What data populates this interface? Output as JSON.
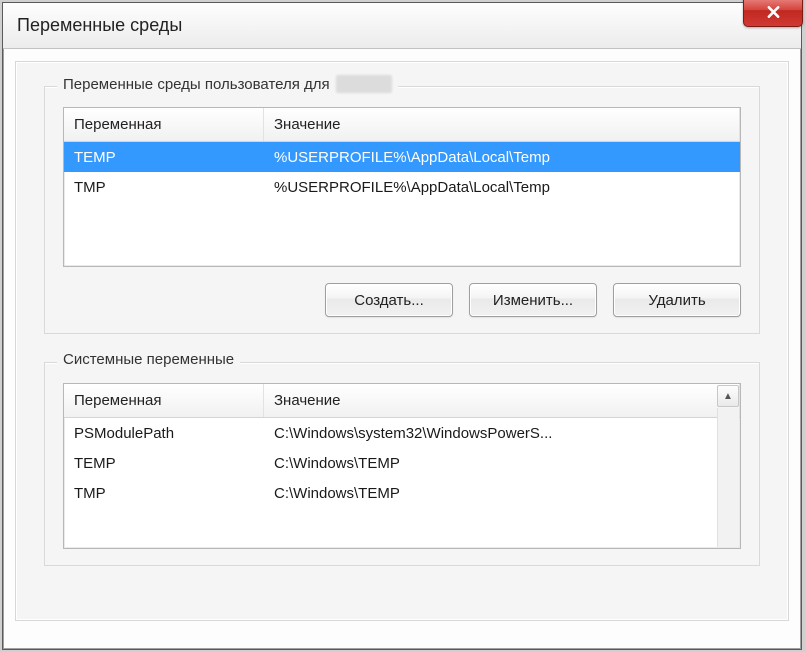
{
  "window": {
    "title": "Переменные среды"
  },
  "userGroup": {
    "label": "Переменные среды пользователя для",
    "columns": {
      "name": "Переменная",
      "value": "Значение"
    },
    "rows": [
      {
        "name": "TEMP",
        "value": "%USERPROFILE%\\AppData\\Local\\Temp",
        "selected": true
      },
      {
        "name": "TMP",
        "value": "%USERPROFILE%\\AppData\\Local\\Temp",
        "selected": false
      }
    ],
    "buttons": {
      "create": "Создать...",
      "edit": "Изменить...",
      "delete": "Удалить"
    }
  },
  "systemGroup": {
    "label": "Системные переменные",
    "columns": {
      "name": "Переменная",
      "value": "Значение"
    },
    "rows": [
      {
        "name": "PSModulePath",
        "value": "C:\\Windows\\system32\\WindowsPowerS..."
      },
      {
        "name": "TEMP",
        "value": "C:\\Windows\\TEMP"
      },
      {
        "name": "TMP",
        "value": "C:\\Windows\\TEMP"
      }
    ]
  },
  "icons": {
    "close": "close-icon",
    "scrollUp": "▲"
  }
}
